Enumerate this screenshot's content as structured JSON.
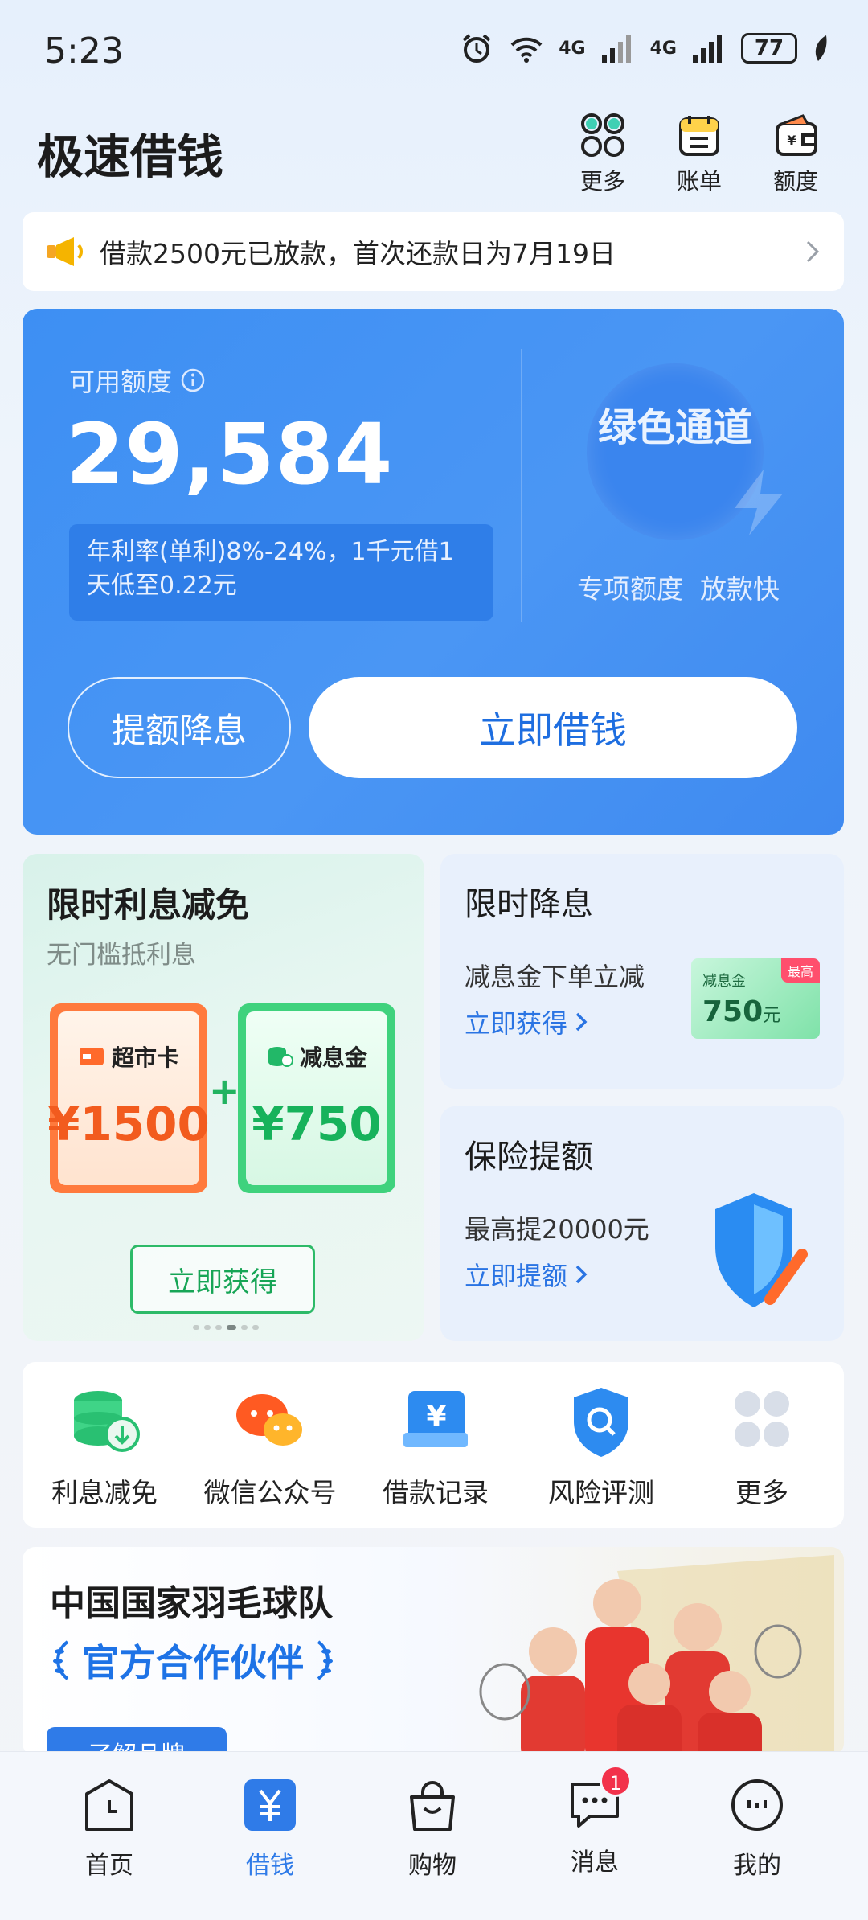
{
  "status_bar": {
    "time": "5:23",
    "signal1_label": "4G",
    "signal2_label": "4G",
    "battery": "77"
  },
  "header": {
    "title": "极速借钱",
    "actions": [
      {
        "label": "更多",
        "icon": "grid-icon"
      },
      {
        "label": "账单",
        "icon": "bill-icon"
      },
      {
        "label": "额度",
        "icon": "wallet-icon"
      }
    ]
  },
  "notice": {
    "text": "借款2500元已放款，首次还款日为7月19日",
    "icon": "megaphone-icon"
  },
  "credit_card": {
    "available_label": "可用额度",
    "available_amount": "29,584",
    "rate_text": "年利率(单利)8%-24%，1千元借1天低至0.22元",
    "green_channel": "绿色通道",
    "special_text": "专项额度  放款快",
    "raise_button": "提额降息",
    "borrow_button": "立即借钱",
    "accent_color": "#3d8ff3"
  },
  "promo_left": {
    "title": "限时利息减免",
    "subtitle": "无门槛抵利息",
    "coupon1": {
      "name": "超市卡",
      "value": "¥1500"
    },
    "coupon2": {
      "name": "减息金",
      "value": "¥750"
    },
    "plus": "+",
    "button": "立即获得"
  },
  "promo_rate": {
    "title": "限时降息",
    "desc": "减息金下单立减",
    "link": "立即获得",
    "coupon_label": "减息金",
    "coupon_tag": "最高",
    "coupon_value": "750",
    "coupon_unit": "元"
  },
  "promo_insurance": {
    "title": "保险提额",
    "desc": "最高提20000元",
    "link": "立即提额"
  },
  "quick_menu": [
    {
      "label": "利息减免",
      "icon": "coins-download-icon"
    },
    {
      "label": "微信公众号",
      "icon": "wechat-icon"
    },
    {
      "label": "借款记录",
      "icon": "record-icon"
    },
    {
      "label": "风险评测",
      "icon": "shield-search-icon"
    },
    {
      "label": "更多",
      "icon": "grid-icon"
    }
  ],
  "banner": {
    "title": "中国国家羽毛球队",
    "subtitle": "官方合作伙伴",
    "button": "了解品牌"
  },
  "bottom_nav": [
    {
      "label": "首页",
      "icon": "clock-icon",
      "active": false
    },
    {
      "label": "借钱",
      "icon": "yuan-icon",
      "active": true
    },
    {
      "label": "购物",
      "icon": "bag-icon",
      "active": false
    },
    {
      "label": "消息",
      "icon": "chat-icon",
      "active": false,
      "badge": "1"
    },
    {
      "label": "我的",
      "icon": "profile-icon",
      "active": false
    }
  ]
}
